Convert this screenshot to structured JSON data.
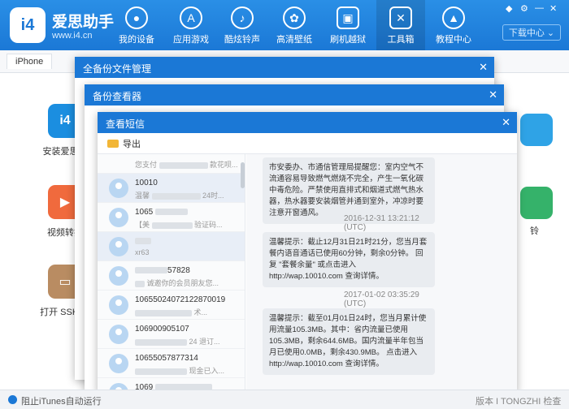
{
  "app": {
    "logo_text": "i4",
    "brand": "爱思助手",
    "url": "www.i4.cn",
    "download_center": "下载中心"
  },
  "nav": [
    {
      "label": "我的设备",
      "icon": "apple-icon"
    },
    {
      "label": "应用游戏",
      "icon": "app-store-icon"
    },
    {
      "label": "酷炫铃声",
      "icon": "bell-icon"
    },
    {
      "label": "高清壁纸",
      "icon": "flower-icon"
    },
    {
      "label": "刷机越狱",
      "icon": "box-icon"
    },
    {
      "label": "工具箱",
      "icon": "tools-icon"
    },
    {
      "label": "教程中心",
      "icon": "graduation-cap-icon"
    }
  ],
  "device_tab": "iPhone",
  "tools": [
    {
      "label": "安装爱思移",
      "icon_text": "i4",
      "color": "#1b8ee0"
    },
    {
      "label": "视频转换",
      "icon_text": "▶",
      "color": "#f06a3d"
    },
    {
      "label": "打开 SSH 通",
      "icon_text": "▭",
      "color": "#b98c62"
    }
  ],
  "right_tool_label": "铃",
  "dialogs": {
    "backup_manager": "全备份文件管理",
    "backup_viewer": "备份查看器",
    "sms_viewer": "查看短信"
  },
  "export_label": "导出",
  "contacts": [
    {
      "name": "",
      "preview": "您支付",
      "preview_tail": "款花呗..."
    },
    {
      "name": "10010",
      "preview": "温馨",
      "preview_tail": "24时..."
    },
    {
      "name": "1065",
      "preview": "【美",
      "preview_tail": "验证码..."
    },
    {
      "name": "",
      "preview": "xr63",
      "preview_tail": ""
    },
    {
      "name": "57828",
      "preview": "",
      "preview_tail": "诚邀你的会员朋友您..."
    },
    {
      "name": "1065502407212287001​9",
      "preview": "",
      "preview_tail": "术..."
    },
    {
      "name": "106900905107",
      "preview": "",
      "preview_tail": "24 退订..."
    },
    {
      "name": "10655057877314",
      "preview": "",
      "preview_tail": "现金已入..."
    },
    {
      "name": "1069",
      "preview": "",
      "preview_tail": ""
    }
  ],
  "messages": [
    {
      "timestamp": "",
      "text": "市安委办、市通信管理局提醒您：室内空气不流通容易导致燃气燃烧不完全，产生一氧化碳中毒危险。严禁使用直排式和烟道式燃气热水器，热水器要安装烟管并通到室外，冲凉时要注意开窗通风。"
    },
    {
      "timestamp": "2016-12-31 13:21:12 (UTC)",
      "text": "温馨提示：截止12月31日21时21分，您当月套餐内语音通话已使用60分钟，剩余0分钟。 回复 \"套餐余量\" 或点击进入 http://wap.10010.com 查询详情。"
    },
    {
      "timestamp": "2017-01-02 03:35:29 (UTC)",
      "text": "温馨提示：截至01月01日24时，您当月累计使用流量105.3MB。其中：省内流量已使用105.3MB，剩余644.6MB。国内流量半年包当月已使用0.0MB，剩余430.9MB。 点击进入 http://wap.10010.com 查询详情。"
    }
  ],
  "status": {
    "itunes": "阻止iTunes自动运行",
    "watermark": "版本 I TONGZHI 检查更新"
  }
}
